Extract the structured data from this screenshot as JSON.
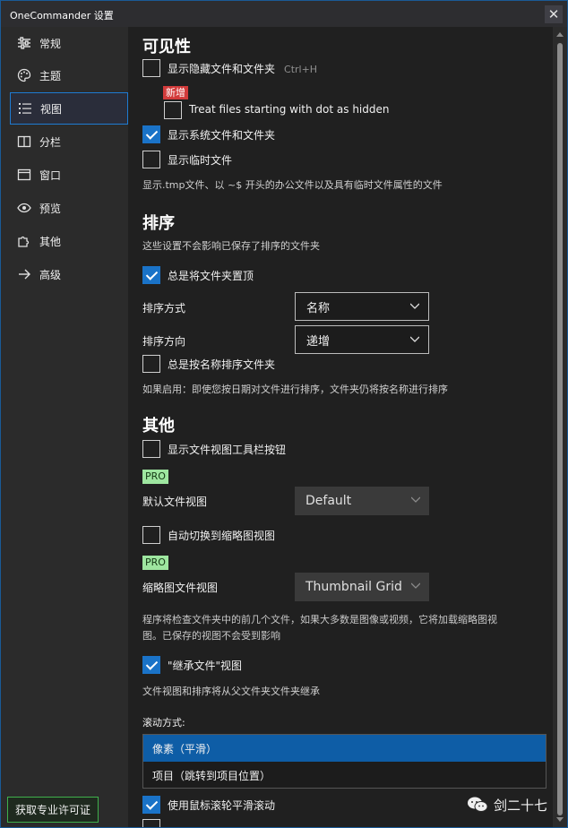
{
  "window": {
    "title": "OneCommander 设置"
  },
  "sidebar": {
    "items": [
      {
        "label": "常规",
        "icon": "sliders-icon"
      },
      {
        "label": "主题",
        "icon": "palette-icon"
      },
      {
        "label": "视图",
        "icon": "list-icon"
      },
      {
        "label": "分栏",
        "icon": "columns-icon"
      },
      {
        "label": "窗口",
        "icon": "window-icon"
      },
      {
        "label": "预览",
        "icon": "eye-icon"
      },
      {
        "label": "其他",
        "icon": "puzzle-icon"
      },
      {
        "label": "高级",
        "icon": "arrow-right-icon"
      }
    ],
    "active_index": 2,
    "license_button": "获取专业许可证"
  },
  "visibility": {
    "heading": "可见性",
    "show_hidden": {
      "label": "显示隐藏文件和文件夹",
      "shortcut": "Ctrl+H",
      "checked": false
    },
    "new_badge": "新增",
    "dot_hidden": {
      "label": "Treat files starting with dot as hidden",
      "checked": false
    },
    "show_system": {
      "label": "显示系统文件和文件夹",
      "checked": true
    },
    "show_temp": {
      "label": "显示临时文件",
      "checked": false
    },
    "temp_desc": "显示.tmp文件、以 ~$ 开头的办公文件以及具有临时文件属性的文件"
  },
  "sorting": {
    "heading": "排序",
    "desc": "这些设置不会影响已保存了排序的文件夹",
    "folders_top": {
      "label": "总是将文件夹置顶",
      "checked": true
    },
    "sort_by_label": "排序方式",
    "sort_by_value": "名称",
    "sort_dir_label": "排序方向",
    "sort_dir_value": "递增",
    "by_name": {
      "label": "总是按名称排序文件夹",
      "checked": false
    },
    "by_name_desc": "如果启用：即使您按日期对文件进行排序，文件夹仍将按名称进行排序"
  },
  "other": {
    "heading": "其他",
    "toolbar_btn": {
      "label": "显示文件视图工具栏按钮",
      "checked": false
    },
    "pro_badge": "PRO",
    "default_view_label": "默认文件视图",
    "default_view_value": "Default",
    "auto_thumb": {
      "label": "自动切换到缩略图视图",
      "checked": false
    },
    "thumb_view_label": "缩略图文件视图",
    "thumb_view_value": "Thumbnail Grid",
    "thumb_desc_1": "程序将检查文件夹中的前几个文件，如果大多数是图像或视频，它将加载缩略图视",
    "thumb_desc_2": "图。已保存的视图不会受到影响",
    "inherit": {
      "label": "\"继承文件\"视图",
      "checked": true
    },
    "inherit_desc": "文件视图和排序将从父文件夹文件夹继承",
    "scroll_label": "滚动方式:",
    "scroll_options": [
      "像素（平滑）",
      "项目（跳转到项目位置）"
    ],
    "scroll_selected": 0,
    "smooth_wheel": {
      "label": "使用鼠标滚轮平滑滚动",
      "checked": true
    }
  },
  "watermark": {
    "text": "剑二十七"
  },
  "colors": {
    "accent": "#1a73c8",
    "selection": "#0e5da6",
    "pro": "#9ee6a0",
    "new": "#d23b3b"
  }
}
